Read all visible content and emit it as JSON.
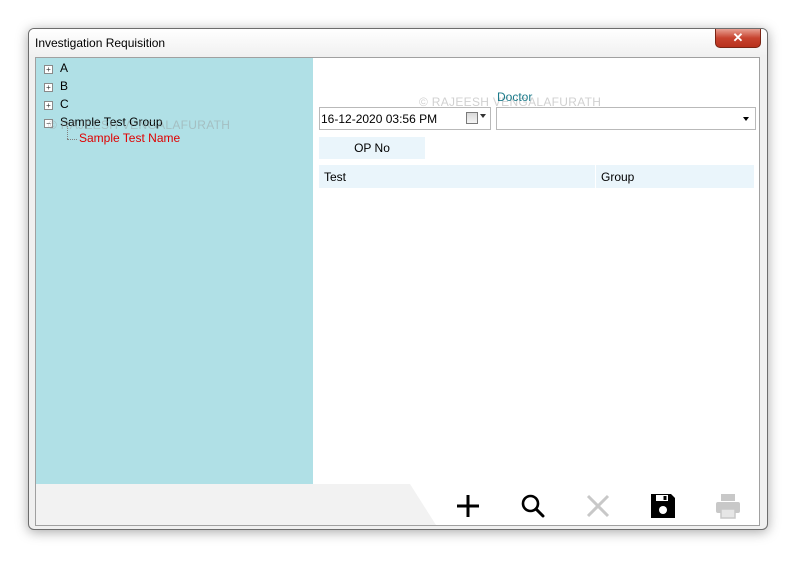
{
  "window": {
    "title": "Investigation Requisition",
    "close_glyph": "✕"
  },
  "tree": {
    "nodes": [
      {
        "label": "A",
        "state": "collapsed"
      },
      {
        "label": "B",
        "state": "collapsed"
      },
      {
        "label": "C",
        "state": "collapsed"
      },
      {
        "label": "Sample Test Group",
        "state": "expanded",
        "children": [
          "Sample Test Name"
        ]
      }
    ],
    "expand_glyph": "+",
    "collapse_glyph": "−"
  },
  "form": {
    "date_value": "16-12-2020 03:56 PM",
    "doctor_label": "Doctor",
    "doctor_value": "",
    "op_no_label": "OP No"
  },
  "grid": {
    "columns": [
      "Test",
      "Group"
    ],
    "rows": []
  },
  "watermark": "© RAJEESH VENGALAFURATH",
  "toolbar": {
    "buttons": [
      {
        "name": "add",
        "icon": "plus-icon",
        "enabled": true
      },
      {
        "name": "search",
        "icon": "search-icon",
        "enabled": true
      },
      {
        "name": "delete",
        "icon": "close-icon",
        "enabled": false
      },
      {
        "name": "save",
        "icon": "floppy-disk-icon",
        "enabled": true
      },
      {
        "name": "print",
        "icon": "printer-icon",
        "enabled": false
      }
    ]
  },
  "colors": {
    "tree_background": "#b0e0e6",
    "selected_child": "#e00000",
    "doctor_label": "#1b7a8a",
    "header_background": "#eaf5fb",
    "disabled_icon": "#c8c8c8"
  }
}
